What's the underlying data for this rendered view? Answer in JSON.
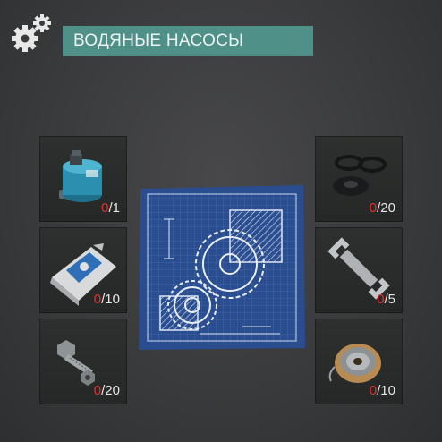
{
  "header": {
    "title": "ВОДЯНЫЕ НАСОСЫ",
    "icon": "gears-icon",
    "accent_color": "#4f9089"
  },
  "blueprint": {
    "icon": "gear-blueprint-icon"
  },
  "left_slots": [
    {
      "item_icon": "water-pump-icon",
      "have": "0",
      "need": "/1"
    },
    {
      "item_icon": "cement-bag-icon",
      "have": "0",
      "need": "/10"
    },
    {
      "item_icon": "bolt-and-nut-icon",
      "have": "0",
      "need": "/20"
    }
  ],
  "right_slots": [
    {
      "item_icon": "rubber-seals-icon",
      "have": "0",
      "need": "/20"
    },
    {
      "item_icon": "wrench-icon",
      "have": "0",
      "need": "/5"
    },
    {
      "item_icon": "wire-spool-icon",
      "have": "0",
      "need": "/10"
    }
  ],
  "colors": {
    "missing": "#e0322c",
    "slot_bg": "#2a2c2b",
    "blueprint": "#2a4d8f"
  }
}
